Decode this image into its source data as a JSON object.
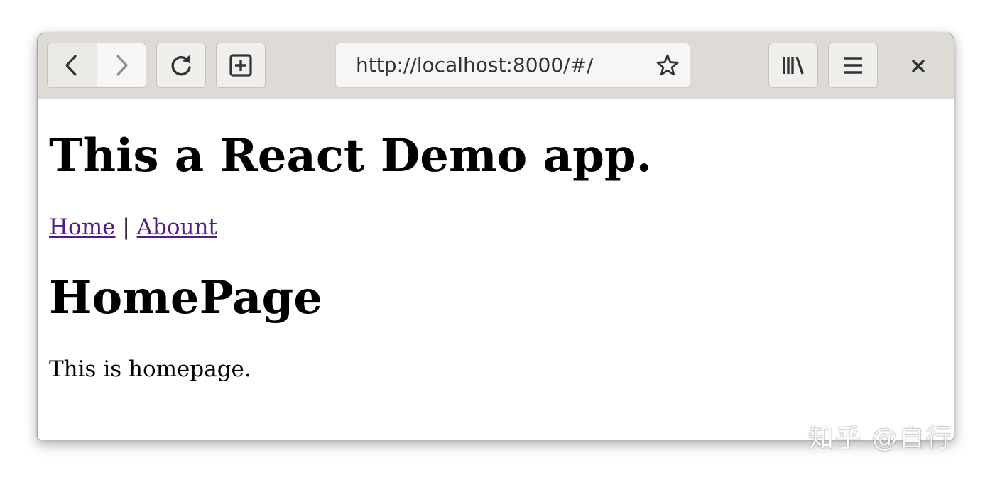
{
  "browser": {
    "url": "http://localhost:8000/#/",
    "icons": {
      "back": "chevron-left-icon",
      "forward": "chevron-right-icon",
      "reload": "reload-icon",
      "new_tab": "new-tab-icon",
      "bookmark": "star-icon",
      "library": "library-icon",
      "menu": "hamburger-menu-icon",
      "close": "close-icon"
    }
  },
  "page": {
    "title": "This a React Demo app.",
    "nav": {
      "home_label": "Home",
      "separator": "|",
      "about_label": "Abount"
    },
    "heading": "HomePage",
    "body_text": "This is homepage."
  },
  "watermark": {
    "text": "知乎 @自行"
  },
  "colors": {
    "toolbar": "#dedbd6",
    "link_visited": "#551a8b",
    "text": "#000000"
  }
}
